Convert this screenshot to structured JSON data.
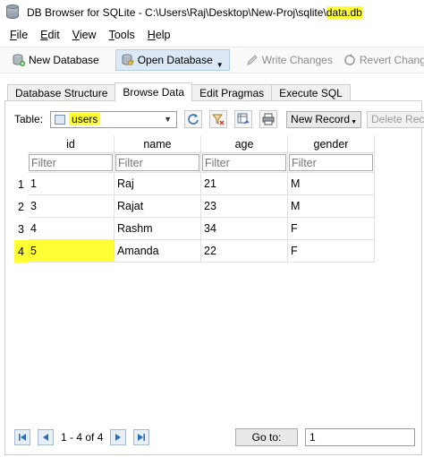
{
  "window": {
    "title_prefix": "DB Browser for SQLite - C:\\Users\\Raj\\Desktop\\New-Proj\\sqlite\\",
    "title_file": "data.db"
  },
  "menu": [
    {
      "label": "File",
      "mnemonic": "F",
      "rest": "ile"
    },
    {
      "label": "Edit",
      "mnemonic": "E",
      "rest": "dit"
    },
    {
      "label": "View",
      "mnemonic": "V",
      "rest": "iew"
    },
    {
      "label": "Tools",
      "mnemonic": "T",
      "rest": "ools"
    },
    {
      "label": "Help",
      "mnemonic": "H",
      "rest": "elp"
    }
  ],
  "toolbar": {
    "new_database": "New Database",
    "open_database": "Open Database",
    "write_changes": "Write Changes",
    "revert_changes": "Revert Changes"
  },
  "tabs": [
    "Database Structure",
    "Browse Data",
    "Edit Pragmas",
    "Execute SQL"
  ],
  "active_tab": "Browse Data",
  "browse": {
    "table_label": "Table:",
    "table_value": "users",
    "new_record": "New Record",
    "delete_record": "Delete Record"
  },
  "grid": {
    "columns": [
      "id",
      "name",
      "age",
      "gender"
    ],
    "filter_placeholder": "Filter",
    "rows": [
      {
        "num": "1",
        "cells": [
          "1",
          "Raj",
          "21",
          "M"
        ]
      },
      {
        "num": "2",
        "cells": [
          "3",
          "Rajat",
          "23",
          "M"
        ]
      },
      {
        "num": "3",
        "cells": [
          "4",
          "Rashm",
          "34",
          "F"
        ]
      },
      {
        "num": "4",
        "cells": [
          "5",
          "Amanda",
          "22",
          "F"
        ]
      }
    ]
  },
  "navigation": {
    "status": "1 - 4 of 4",
    "goto_label": "Go to:",
    "goto_value": "1"
  },
  "colors": {
    "highlight": "#ffff33",
    "selected_toolbar": "#dbe8f5"
  }
}
